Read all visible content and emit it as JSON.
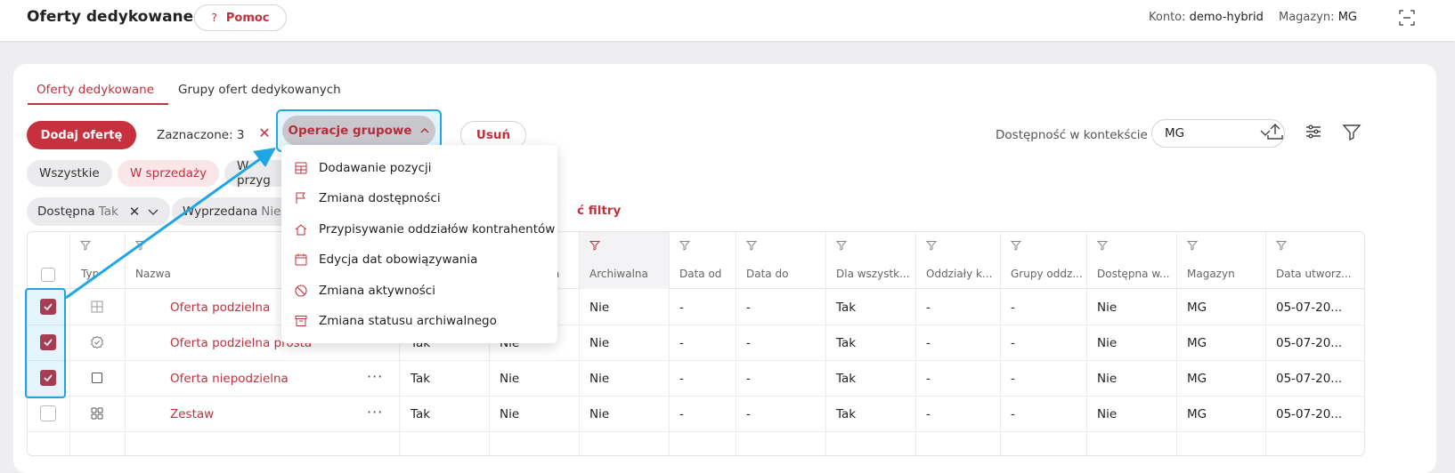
{
  "header": {
    "title": "Oferty dedykowane",
    "help_label": "Pomoc",
    "account_label": "Konto:",
    "account_value": "demo-hybrid",
    "warehouse_label": "Magazyn:",
    "warehouse_value": "MG"
  },
  "tabs": [
    {
      "label": "Oferty dedykowane",
      "active": true
    },
    {
      "label": "Grupy ofert dedykowanych",
      "active": false
    }
  ],
  "toolbar": {
    "add_label": "Dodaj ofertę",
    "selected_label": "Zaznaczone: 3",
    "group_ops_label": "Operacje grupowe",
    "delete_label": "Usuń",
    "context_label": "Dostępność w kontekście",
    "context_value": "MG"
  },
  "status_chips": [
    "Wszystkie",
    "W sprzedaży",
    "W przyg"
  ],
  "filters": [
    {
      "name": "Dostępna",
      "value": "Tak"
    },
    {
      "name": "Wyprzedana",
      "value": "Nie"
    }
  ],
  "clear_filters_label": "ć filtry",
  "dropdown": {
    "items": [
      {
        "label": "Dodawanie pozycji",
        "icon": "add-rows-icon"
      },
      {
        "label": "Zmiana dostępności",
        "icon": "flag-icon"
      },
      {
        "label": "Przypisywanie oddziałów kontrahentów",
        "icon": "home-icon"
      },
      {
        "label": "Edycja dat obowiązywania",
        "icon": "calendar-icon"
      },
      {
        "label": "Zmiana aktywności",
        "icon": "block-icon"
      },
      {
        "label": "Zmiana statusu archiwalnego",
        "icon": "archive-icon"
      }
    ]
  },
  "table": {
    "columns": [
      "Typ",
      "Nazwa",
      "a",
      "Archiwalna",
      "Data od",
      "Data do",
      "Dla wszystk...",
      "Oddziały k...",
      "Grupy oddz...",
      "Dostępna w...",
      "Magazyn",
      "Data utworz..."
    ],
    "rows": [
      {
        "checked": true,
        "type_icon": "split-grid-icon",
        "name": "Oferta podzielna",
        "col3": "",
        "col4": "",
        "archiwalna": "Nie",
        "data_od": "-",
        "data_do": "-",
        "dla_wszystkich": "Tak",
        "oddzialy": "-",
        "grupy": "-",
        "dostepna": "Nie",
        "magazyn": "MG",
        "data_utworzenia": "05-07-20..."
      },
      {
        "checked": true,
        "type_icon": "check-badge-icon",
        "name": "Oferta podzielna prosta",
        "col3": "Tak",
        "col4": "Nie",
        "archiwalna": "Nie",
        "data_od": "-",
        "data_do": "-",
        "dla_wszystkich": "Tak",
        "oddzialy": "-",
        "grupy": "-",
        "dostepna": "Nie",
        "magazyn": "MG",
        "data_utworzenia": "05-07-20..."
      },
      {
        "checked": true,
        "type_icon": "square-icon",
        "name": "Oferta niepodzielna",
        "col3": "Tak",
        "col4": "Nie",
        "archiwalna": "Nie",
        "data_od": "-",
        "data_do": "-",
        "dla_wszystkich": "Tak",
        "oddzialy": "-",
        "grupy": "-",
        "dostepna": "Nie",
        "magazyn": "MG",
        "data_utworzenia": "05-07-20..."
      },
      {
        "checked": false,
        "type_icon": "grid-icon",
        "name": "Zestaw",
        "col3": "Tak",
        "col4": "Nie",
        "archiwalna": "Nie",
        "data_od": "-",
        "data_do": "-",
        "dla_wszystkich": "Tak",
        "oddzialy": "-",
        "grupy": "-",
        "dostepna": "Nie",
        "magazyn": "MG",
        "data_utworzenia": "05-07-20..."
      }
    ]
  },
  "colors": {
    "accent": "#c0303d",
    "highlight": "#1ea7e4"
  }
}
